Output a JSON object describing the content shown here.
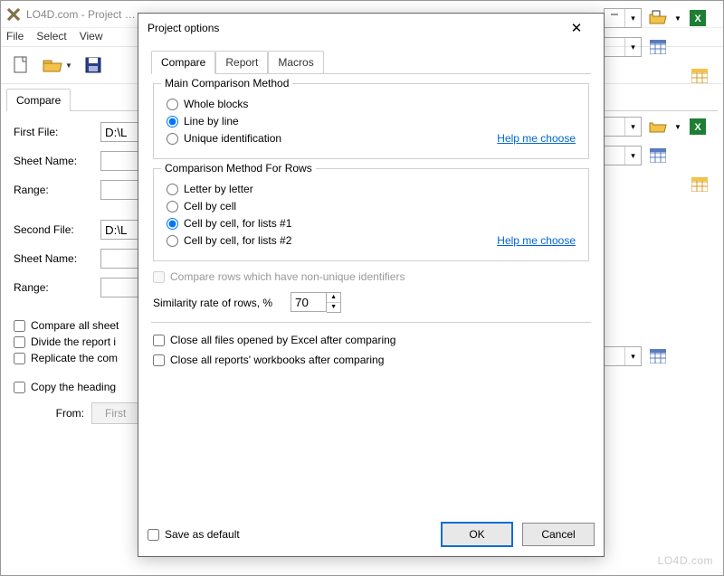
{
  "window": {
    "title": "LO4D.com - Project …",
    "app_icon": "lo4d-logo"
  },
  "menubar": [
    "File",
    "Select",
    "View"
  ],
  "main_tab": "Compare",
  "form": {
    "section1": {
      "file_label": "First File:",
      "file_value": "D:\\L",
      "sheet_label": "Sheet Name:",
      "range_label": "Range:"
    },
    "section2": {
      "file_label": "Second File:",
      "file_value": "D:\\L",
      "sheet_label": "Sheet Name:",
      "range_label": "Range:"
    },
    "checks": [
      "Compare all sheet",
      "Divide the report i",
      "Replicate the com"
    ],
    "copy_check": "Copy the heading",
    "from_label": "From:",
    "from_btn": "First"
  },
  "dialog": {
    "title": "Project options",
    "tabs": [
      "Compare",
      "Report",
      "Macros"
    ],
    "group1": {
      "title": "Main Comparison Method",
      "opts": [
        "Whole blocks",
        "Line by line",
        "Unique identification"
      ],
      "selected": 1,
      "help": "Help me choose"
    },
    "group2": {
      "title": "Comparison Method For Rows",
      "opts": [
        "Letter by letter",
        "Cell by cell",
        "Cell by cell, for lists #1",
        "Cell by cell, for lists #2"
      ],
      "selected": 2,
      "help": "Help me choose"
    },
    "compare_rows_disabled": "Compare rows which have non-unique identifiers",
    "similarity_label": "Similarity rate of rows, %",
    "similarity_value": "70",
    "closing_checks": [
      "Close all files opened by Excel after comparing",
      "Close all reports' workbooks after comparing"
    ],
    "save_default": "Save as default",
    "ok": "OK",
    "cancel": "Cancel"
  },
  "watermark": "LO4D.com"
}
